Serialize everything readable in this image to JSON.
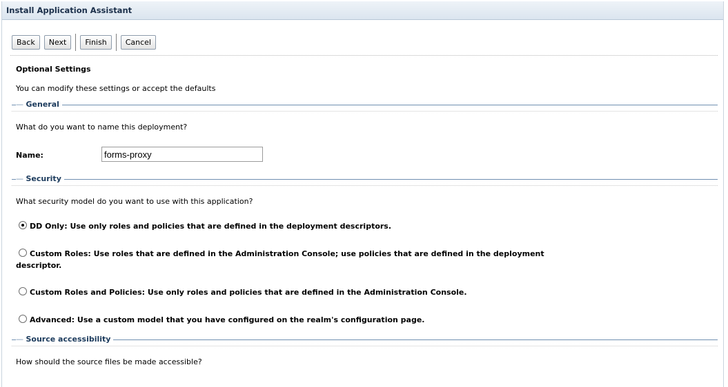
{
  "window": {
    "title": "Install Application Assistant"
  },
  "toolbar": {
    "back": "Back",
    "next": "Next",
    "finish": "Finish",
    "cancel": "Cancel"
  },
  "page": {
    "heading": "Optional Settings",
    "description": "You can modify these settings or accept the defaults"
  },
  "general": {
    "title": "General",
    "question": "What do you want to name this deployment?",
    "name_label": "Name:",
    "name_value": "forms-proxy"
  },
  "security": {
    "title": "Security",
    "question": "What security model do you want to use with this application?",
    "options": [
      {
        "label": "DD Only: Use only roles and policies that are defined in the deployment descriptors.",
        "selected": true
      },
      {
        "label": "Custom Roles: Use roles that are defined in the Administration Console; use policies that are defined in the deployment",
        "label_cont": "descriptor.",
        "selected": false
      },
      {
        "label": "Custom Roles and Policies: Use only roles and policies that are defined in the Administration Console.",
        "selected": false
      },
      {
        "label": "Advanced: Use a custom model that you have configured on the realm's configuration page.",
        "selected": false
      }
    ]
  },
  "source": {
    "title": "Source accessibility",
    "question": "How should the source files be made accessible?"
  }
}
